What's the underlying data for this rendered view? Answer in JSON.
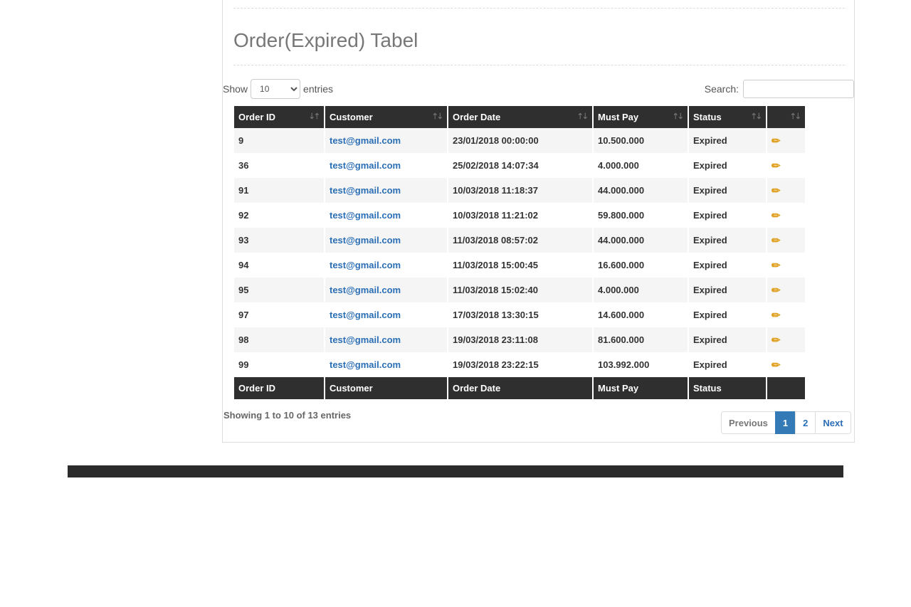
{
  "page": {
    "title": "Order(Expired) Tabel"
  },
  "controls": {
    "show_label": "Show",
    "entries_label": "entries",
    "length_value": "10",
    "search_label": "Search:",
    "search_value": ""
  },
  "table": {
    "headers": [
      "Order ID",
      "Customer",
      "Order Date",
      "Must Pay",
      "Status",
      ""
    ],
    "rows": [
      {
        "id": "9",
        "customer": "test@gmail.com",
        "date": "23/01/2018 00:00:00",
        "pay": "10.500.000",
        "status": "Expired"
      },
      {
        "id": "36",
        "customer": "test@gmail.com",
        "date": "25/02/2018 14:07:34",
        "pay": "4.000.000",
        "status": "Expired"
      },
      {
        "id": "91",
        "customer": "test@gmail.com",
        "date": "10/03/2018 11:18:37",
        "pay": "44.000.000",
        "status": "Expired"
      },
      {
        "id": "92",
        "customer": "test@gmail.com",
        "date": "10/03/2018 11:21:02",
        "pay": "59.800.000",
        "status": "Expired"
      },
      {
        "id": "93",
        "customer": "test@gmail.com",
        "date": "11/03/2018 08:57:02",
        "pay": "44.000.000",
        "status": "Expired"
      },
      {
        "id": "94",
        "customer": "test@gmail.com",
        "date": "11/03/2018 15:00:45",
        "pay": "16.600.000",
        "status": "Expired"
      },
      {
        "id": "95",
        "customer": "test@gmail.com",
        "date": "11/03/2018 15:02:40",
        "pay": "4.000.000",
        "status": "Expired"
      },
      {
        "id": "97",
        "customer": "test@gmail.com",
        "date": "17/03/2018 13:30:15",
        "pay": "14.600.000",
        "status": "Expired"
      },
      {
        "id": "98",
        "customer": "test@gmail.com",
        "date": "19/03/2018 23:11:08",
        "pay": "81.600.000",
        "status": "Expired"
      },
      {
        "id": "99",
        "customer": "test@gmail.com",
        "date": "19/03/2018 23:22:15",
        "pay": "103.992.000",
        "status": "Expired"
      }
    ],
    "footers": [
      "Order ID",
      "Customer",
      "Order Date",
      "Must Pay",
      "Status",
      ""
    ]
  },
  "info": "Showing 1 to 10 of 13 entries",
  "pagination": {
    "previous": "Previous",
    "pages": [
      "1",
      "2"
    ],
    "active_page": "1",
    "next": "Next"
  },
  "icons": {
    "edit": "pencil-icon",
    "sort": "sort-icon"
  },
  "colors": {
    "header_bg": "#2f2f2f",
    "link": "#2a6eb5",
    "active_page": "#337ab7",
    "edit_icon": "#e0a020"
  }
}
